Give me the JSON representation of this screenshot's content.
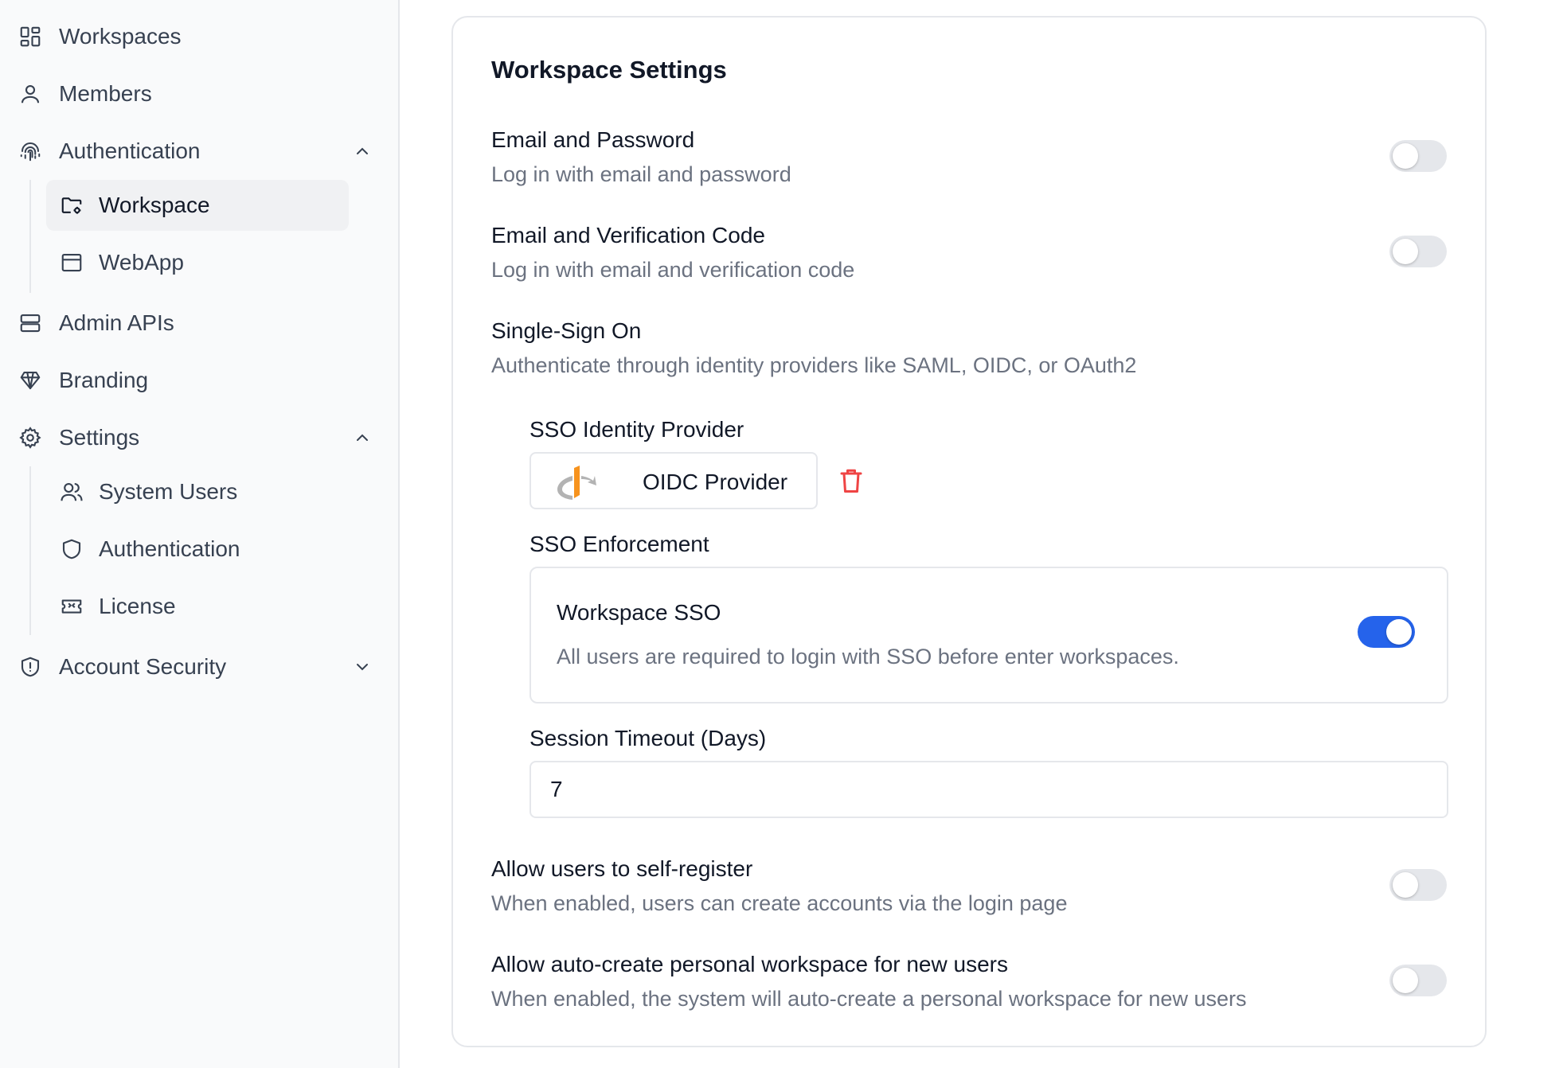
{
  "sidebar": {
    "items": [
      {
        "label": "Workspaces",
        "icon": "grid-icon"
      },
      {
        "label": "Members",
        "icon": "user-icon"
      },
      {
        "label": "Authentication",
        "icon": "fingerprint-icon",
        "expanded": true
      },
      {
        "label": "Admin APIs",
        "icon": "server-icon"
      },
      {
        "label": "Branding",
        "icon": "diamond-icon"
      },
      {
        "label": "Settings",
        "icon": "gear-icon",
        "expanded": true
      },
      {
        "label": "Account Security",
        "icon": "shield-alert-icon",
        "expanded": false
      }
    ],
    "auth_sub": [
      {
        "label": "Workspace",
        "icon": "folder-gear-icon",
        "active": true
      },
      {
        "label": "WebApp",
        "icon": "browser-window-icon"
      }
    ],
    "settings_sub": [
      {
        "label": "System Users",
        "icon": "users-icon"
      },
      {
        "label": "Authentication",
        "icon": "shield-icon"
      },
      {
        "label": "License",
        "icon": "ticket-icon"
      }
    ]
  },
  "card": {
    "title": "Workspace Settings",
    "email_password": {
      "title": "Email and Password",
      "desc": "Log in with email and password",
      "enabled": false
    },
    "email_code": {
      "title": "Email and Verification Code",
      "desc": "Log in with email and verification code",
      "enabled": false
    },
    "sso": {
      "title": "Single-Sign On",
      "desc": "Authenticate through identity providers like SAML, OIDC, or OAuth2"
    },
    "provider": {
      "label": "SSO Identity Provider",
      "name": "OIDC Provider"
    },
    "enforcement": {
      "label": "SSO Enforcement",
      "title": "Workspace SSO",
      "desc": "All users are required to login with SSO before enter workspaces.",
      "enabled": true
    },
    "timeout": {
      "label": "Session Timeout (Days)",
      "value": "7"
    },
    "self_register": {
      "title": "Allow users to self-register",
      "desc": "When enabled, users can create accounts via the login page",
      "enabled": false
    },
    "auto_workspace": {
      "title": "Allow auto-create personal workspace for new users",
      "desc": "When enabled, the system will auto-create a personal workspace for new users",
      "enabled": false
    }
  },
  "colors": {
    "accent": "#2563eb",
    "danger": "#ef4444",
    "muted": "#6b7280",
    "border": "#e5e7eb"
  }
}
